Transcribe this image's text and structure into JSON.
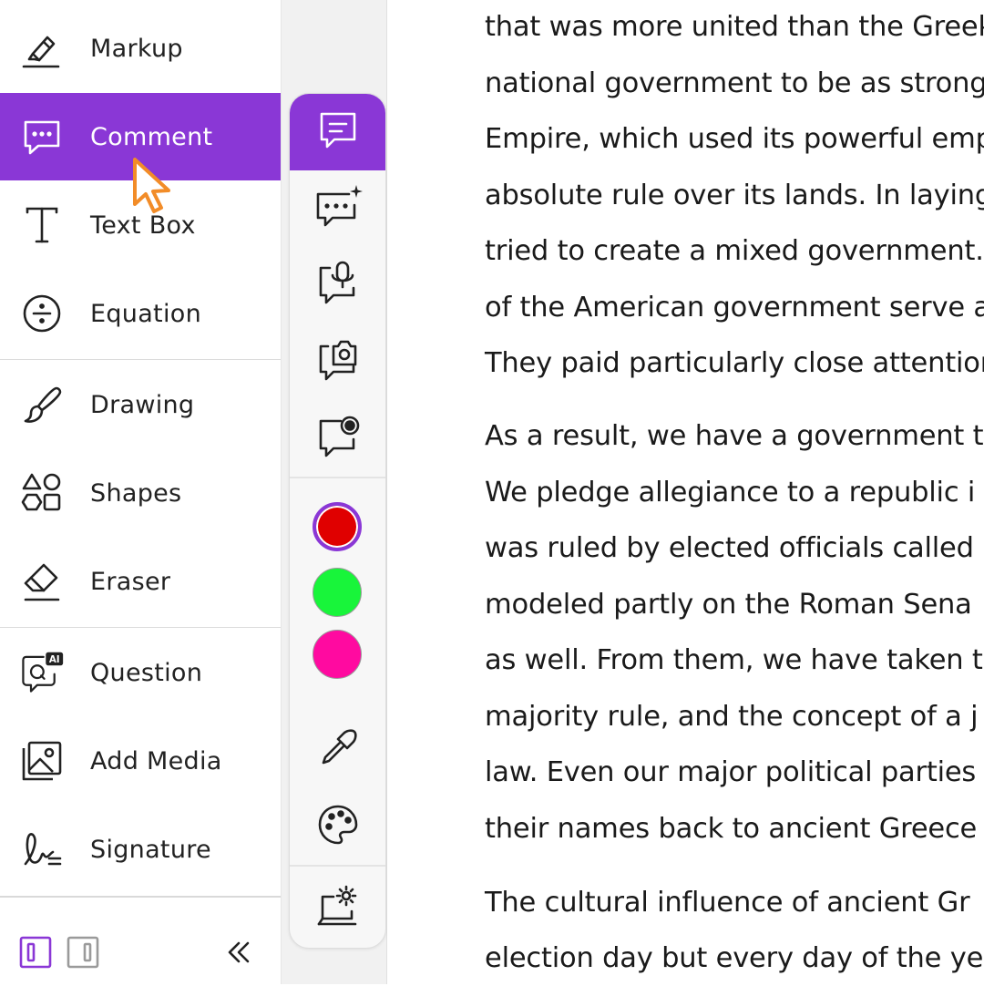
{
  "sidebar": {
    "items": [
      {
        "label": "Markup",
        "icon": "highlighter-icon"
      },
      {
        "label": "Comment",
        "icon": "comment-icon",
        "active": true
      },
      {
        "label": "Text Box",
        "icon": "text-box-icon"
      },
      {
        "label": "Equation",
        "icon": "divide-icon"
      },
      {
        "label": "Drawing",
        "icon": "brush-icon"
      },
      {
        "label": "Shapes",
        "icon": "shapes-icon"
      },
      {
        "label": "Eraser",
        "icon": "eraser-icon"
      },
      {
        "label": "Question",
        "icon": "ai-question-icon",
        "badge": "AI"
      },
      {
        "label": "Add Media",
        "icon": "image-icon"
      },
      {
        "label": "Signature",
        "icon": "signature-icon"
      }
    ],
    "bottom": {
      "left_panel_icon": "dock-left-icon",
      "right_panel_icon": "dock-right-icon",
      "collapse_icon": "double-chevron-left-icon"
    }
  },
  "comment_tools": [
    {
      "name": "text-comment",
      "icon": "text-comment-icon",
      "active": true
    },
    {
      "name": "ai-comment",
      "icon": "ai-comment-icon"
    },
    {
      "name": "voice-comment",
      "icon": "voice-comment-icon"
    },
    {
      "name": "photo-comment",
      "icon": "camera-comment-icon"
    },
    {
      "name": "video-comment",
      "icon": "video-comment-icon"
    }
  ],
  "colors": {
    "accent": "#8a37d6",
    "cursor": "#f28c28",
    "swatches": [
      {
        "color": "#e00000",
        "selected": true
      },
      {
        "color": "#18f53a",
        "selected": false
      },
      {
        "color": "#ff0aa0",
        "selected": false
      }
    ]
  },
  "color_tools": {
    "eyedropper_icon": "eyedropper-icon",
    "palette_icon": "palette-icon",
    "settings_icon": "comment-settings-icon"
  },
  "document": {
    "lines": [
      "that was more united than the Greek",
      "national government to be as strong",
      "Empire, which used its powerful emp",
      "absolute rule over its lands. In laying",
      "tried to create a mixed government.",
      "of the American government serve a",
      "They paid particularly close attentior",
      "As a result, we have a government t",
      "We pledge allegiance to a republic i",
      "was ruled by elected officials called",
      "modeled partly on the Roman Sena",
      "as well. From them, we have taken t",
      "majority rule, and the concept of a j",
      "law. Even our major political parties",
      "their names back to ancient Greece",
      "The cultural influence of ancient Gr",
      "election day but every day of the ye"
    ]
  }
}
